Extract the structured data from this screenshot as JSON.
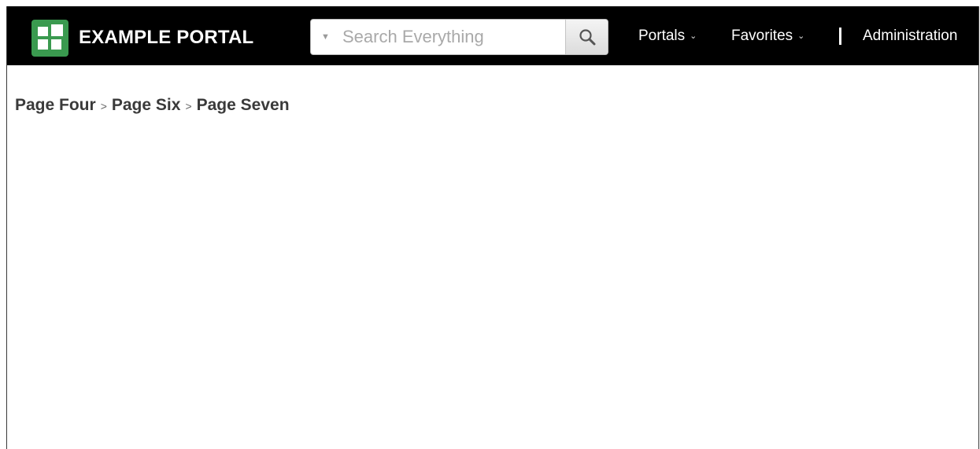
{
  "header": {
    "brand_name": "EXAMPLE PORTAL",
    "brand_color": "#3a9a4f",
    "logo_icon": "grid-logo-icon",
    "search": {
      "placeholder": "Search Everything",
      "value": "",
      "dropdown_icon": "caret-down-icon",
      "button_icon": "search-icon"
    },
    "nav": {
      "portals_label": "Portals",
      "favorites_label": "Favorites",
      "administration_label": "Administration",
      "dropdown_icon": "chevron-down-icon"
    }
  },
  "breadcrumb": {
    "items": [
      "Page Four",
      "Page Six",
      "Page Seven"
    ],
    "separator": ">"
  }
}
